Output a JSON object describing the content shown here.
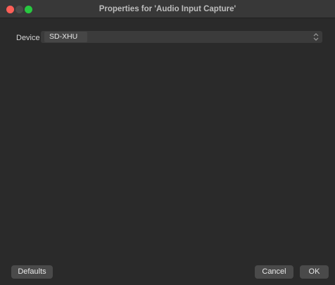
{
  "window": {
    "title": "Properties for 'Audio Input Capture'"
  },
  "form": {
    "device_label": "Device",
    "device_value": "SD-XHU"
  },
  "buttons": {
    "defaults": "Defaults",
    "cancel": "Cancel",
    "ok": "OK"
  },
  "icons": {
    "select_arrows": "updown-chevron-icon"
  },
  "colors": {
    "close": "#ff5f57",
    "minimize": "#4a4a4a",
    "zoom": "#28c840",
    "background": "#2a2a2a"
  }
}
